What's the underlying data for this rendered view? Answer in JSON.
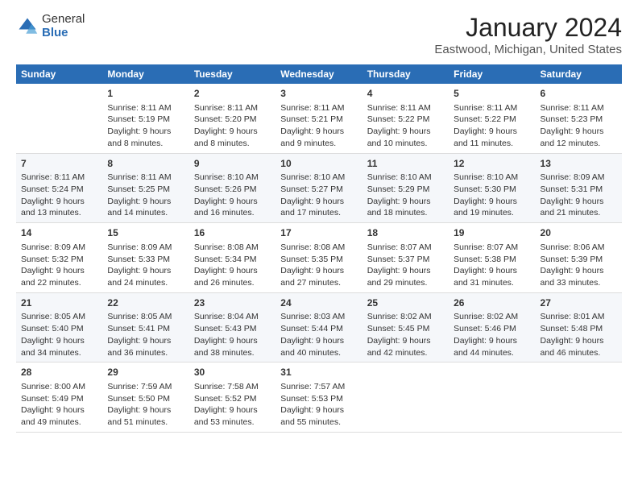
{
  "header": {
    "logo_general": "General",
    "logo_blue": "Blue",
    "title": "January 2024",
    "subtitle": "Eastwood, Michigan, United States"
  },
  "calendar": {
    "days_of_week": [
      "Sunday",
      "Monday",
      "Tuesday",
      "Wednesday",
      "Thursday",
      "Friday",
      "Saturday"
    ],
    "weeks": [
      [
        {
          "day": "",
          "lines": []
        },
        {
          "day": "1",
          "lines": [
            "Sunrise: 8:11 AM",
            "Sunset: 5:19 PM",
            "Daylight: 9 hours",
            "and 8 minutes."
          ]
        },
        {
          "day": "2",
          "lines": [
            "Sunrise: 8:11 AM",
            "Sunset: 5:20 PM",
            "Daylight: 9 hours",
            "and 8 minutes."
          ]
        },
        {
          "day": "3",
          "lines": [
            "Sunrise: 8:11 AM",
            "Sunset: 5:21 PM",
            "Daylight: 9 hours",
            "and 9 minutes."
          ]
        },
        {
          "day": "4",
          "lines": [
            "Sunrise: 8:11 AM",
            "Sunset: 5:22 PM",
            "Daylight: 9 hours",
            "and 10 minutes."
          ]
        },
        {
          "day": "5",
          "lines": [
            "Sunrise: 8:11 AM",
            "Sunset: 5:22 PM",
            "Daylight: 9 hours",
            "and 11 minutes."
          ]
        },
        {
          "day": "6",
          "lines": [
            "Sunrise: 8:11 AM",
            "Sunset: 5:23 PM",
            "Daylight: 9 hours",
            "and 12 minutes."
          ]
        }
      ],
      [
        {
          "day": "7",
          "lines": [
            "Sunrise: 8:11 AM",
            "Sunset: 5:24 PM",
            "Daylight: 9 hours",
            "and 13 minutes."
          ]
        },
        {
          "day": "8",
          "lines": [
            "Sunrise: 8:11 AM",
            "Sunset: 5:25 PM",
            "Daylight: 9 hours",
            "and 14 minutes."
          ]
        },
        {
          "day": "9",
          "lines": [
            "Sunrise: 8:10 AM",
            "Sunset: 5:26 PM",
            "Daylight: 9 hours",
            "and 16 minutes."
          ]
        },
        {
          "day": "10",
          "lines": [
            "Sunrise: 8:10 AM",
            "Sunset: 5:27 PM",
            "Daylight: 9 hours",
            "and 17 minutes."
          ]
        },
        {
          "day": "11",
          "lines": [
            "Sunrise: 8:10 AM",
            "Sunset: 5:29 PM",
            "Daylight: 9 hours",
            "and 18 minutes."
          ]
        },
        {
          "day": "12",
          "lines": [
            "Sunrise: 8:10 AM",
            "Sunset: 5:30 PM",
            "Daylight: 9 hours",
            "and 19 minutes."
          ]
        },
        {
          "day": "13",
          "lines": [
            "Sunrise: 8:09 AM",
            "Sunset: 5:31 PM",
            "Daylight: 9 hours",
            "and 21 minutes."
          ]
        }
      ],
      [
        {
          "day": "14",
          "lines": [
            "Sunrise: 8:09 AM",
            "Sunset: 5:32 PM",
            "Daylight: 9 hours",
            "and 22 minutes."
          ]
        },
        {
          "day": "15",
          "lines": [
            "Sunrise: 8:09 AM",
            "Sunset: 5:33 PM",
            "Daylight: 9 hours",
            "and 24 minutes."
          ]
        },
        {
          "day": "16",
          "lines": [
            "Sunrise: 8:08 AM",
            "Sunset: 5:34 PM",
            "Daylight: 9 hours",
            "and 26 minutes."
          ]
        },
        {
          "day": "17",
          "lines": [
            "Sunrise: 8:08 AM",
            "Sunset: 5:35 PM",
            "Daylight: 9 hours",
            "and 27 minutes."
          ]
        },
        {
          "day": "18",
          "lines": [
            "Sunrise: 8:07 AM",
            "Sunset: 5:37 PM",
            "Daylight: 9 hours",
            "and 29 minutes."
          ]
        },
        {
          "day": "19",
          "lines": [
            "Sunrise: 8:07 AM",
            "Sunset: 5:38 PM",
            "Daylight: 9 hours",
            "and 31 minutes."
          ]
        },
        {
          "day": "20",
          "lines": [
            "Sunrise: 8:06 AM",
            "Sunset: 5:39 PM",
            "Daylight: 9 hours",
            "and 33 minutes."
          ]
        }
      ],
      [
        {
          "day": "21",
          "lines": [
            "Sunrise: 8:05 AM",
            "Sunset: 5:40 PM",
            "Daylight: 9 hours",
            "and 34 minutes."
          ]
        },
        {
          "day": "22",
          "lines": [
            "Sunrise: 8:05 AM",
            "Sunset: 5:41 PM",
            "Daylight: 9 hours",
            "and 36 minutes."
          ]
        },
        {
          "day": "23",
          "lines": [
            "Sunrise: 8:04 AM",
            "Sunset: 5:43 PM",
            "Daylight: 9 hours",
            "and 38 minutes."
          ]
        },
        {
          "day": "24",
          "lines": [
            "Sunrise: 8:03 AM",
            "Sunset: 5:44 PM",
            "Daylight: 9 hours",
            "and 40 minutes."
          ]
        },
        {
          "day": "25",
          "lines": [
            "Sunrise: 8:02 AM",
            "Sunset: 5:45 PM",
            "Daylight: 9 hours",
            "and 42 minutes."
          ]
        },
        {
          "day": "26",
          "lines": [
            "Sunrise: 8:02 AM",
            "Sunset: 5:46 PM",
            "Daylight: 9 hours",
            "and 44 minutes."
          ]
        },
        {
          "day": "27",
          "lines": [
            "Sunrise: 8:01 AM",
            "Sunset: 5:48 PM",
            "Daylight: 9 hours",
            "and 46 minutes."
          ]
        }
      ],
      [
        {
          "day": "28",
          "lines": [
            "Sunrise: 8:00 AM",
            "Sunset: 5:49 PM",
            "Daylight: 9 hours",
            "and 49 minutes."
          ]
        },
        {
          "day": "29",
          "lines": [
            "Sunrise: 7:59 AM",
            "Sunset: 5:50 PM",
            "Daylight: 9 hours",
            "and 51 minutes."
          ]
        },
        {
          "day": "30",
          "lines": [
            "Sunrise: 7:58 AM",
            "Sunset: 5:52 PM",
            "Daylight: 9 hours",
            "and 53 minutes."
          ]
        },
        {
          "day": "31",
          "lines": [
            "Sunrise: 7:57 AM",
            "Sunset: 5:53 PM",
            "Daylight: 9 hours",
            "and 55 minutes."
          ]
        },
        {
          "day": "",
          "lines": []
        },
        {
          "day": "",
          "lines": []
        },
        {
          "day": "",
          "lines": []
        }
      ]
    ]
  }
}
